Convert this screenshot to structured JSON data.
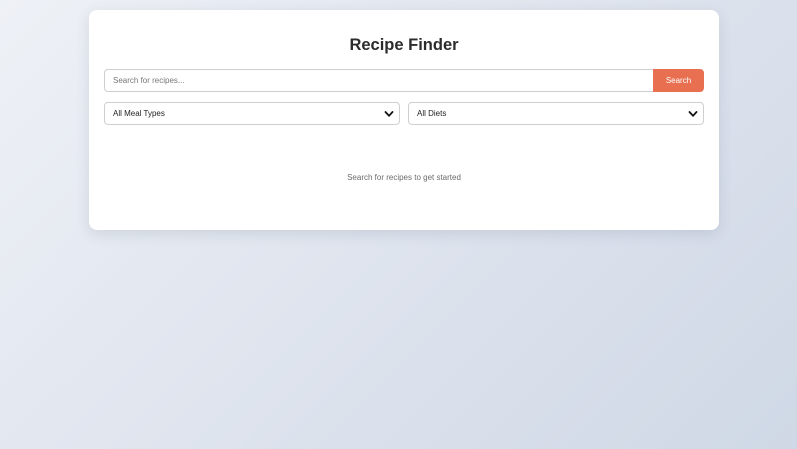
{
  "app": {
    "title": "Recipe Finder"
  },
  "search": {
    "placeholder": "Search for recipes...",
    "value": "",
    "button_label": "Search"
  },
  "filters": {
    "meal_type": {
      "selected": "All Meal Types"
    },
    "diet": {
      "selected": "All Diets"
    }
  },
  "results": {
    "empty_message": "Search for recipes to get started"
  },
  "colors": {
    "accent": "#e86f50",
    "title_text": "#2c2c2c",
    "muted_text": "#6b6b6b"
  },
  "icons": {
    "dropdown": "chevron-down-icon"
  }
}
